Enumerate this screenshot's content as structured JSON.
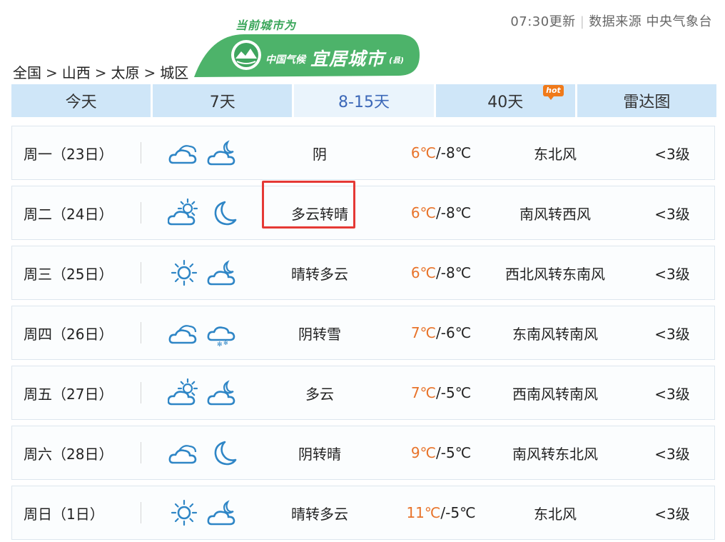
{
  "meta": {
    "update_time": "07:30更新",
    "source": "数据来源 中央气象台"
  },
  "breadcrumb": [
    {
      "label": "全国"
    },
    {
      "label": "山西"
    },
    {
      "label": "太原"
    },
    {
      "label": "城区"
    }
  ],
  "badge": {
    "top_text": "当前城市为",
    "small_text": "中国气候",
    "big_text": "宜居城市",
    "county_text": "(县)"
  },
  "tabs": [
    {
      "label": "今天",
      "active": false
    },
    {
      "label": "7天",
      "active": false
    },
    {
      "label": "8-15天",
      "active": true
    },
    {
      "label": "40天",
      "active": false,
      "badge": "hot"
    },
    {
      "label": "雷达图",
      "active": false
    }
  ],
  "forecast": [
    {
      "day": "周一（23日）",
      "icon_day": "cloudy-icon",
      "icon_night": "cloudy-night-icon",
      "condition": "阴",
      "high": "6℃",
      "low": "-8℃",
      "wind": "东北风",
      "level": "<3级"
    },
    {
      "day": "周二（24日）",
      "icon_day": "partly-cloudy-icon",
      "icon_night": "moon-icon",
      "condition": "多云转晴",
      "high": "6℃",
      "low": "-8℃",
      "wind": "南风转西风",
      "level": "<3级"
    },
    {
      "day": "周三（25日）",
      "icon_day": "sun-icon",
      "icon_night": "cloudy-night-icon",
      "condition": "晴转多云",
      "high": "6℃",
      "low": "-8℃",
      "wind": "西北风转东南风",
      "level": "<3级"
    },
    {
      "day": "周四（26日）",
      "icon_day": "cloudy-icon",
      "icon_night": "snow-icon",
      "condition": "阴转雪",
      "high": "7℃",
      "low": "-6℃",
      "wind": "东南风转南风",
      "level": "<3级"
    },
    {
      "day": "周五（27日）",
      "icon_day": "partly-cloudy-icon",
      "icon_night": "cloudy-night-icon",
      "condition": "多云",
      "high": "7℃",
      "low": "-5℃",
      "wind": "西南风转南风",
      "level": "<3级"
    },
    {
      "day": "周六（28日）",
      "icon_day": "cloudy-icon",
      "icon_night": "moon-icon",
      "condition": "阴转晴",
      "high": "9℃",
      "low": "-5℃",
      "wind": "南风转东北风",
      "level": "<3级"
    },
    {
      "day": "周日（1日）",
      "icon_day": "sun-icon",
      "icon_night": "cloudy-night-icon",
      "condition": "晴转多云",
      "high": "11℃",
      "low": "-5℃",
      "wind": "东北风",
      "level": "<3级"
    }
  ],
  "colors": {
    "accent": "#3c68b8",
    "tab_bg": "#cfe6f8",
    "temp_high": "#e8732a",
    "icon": "#2f86c6",
    "highlight": "#e53935"
  }
}
